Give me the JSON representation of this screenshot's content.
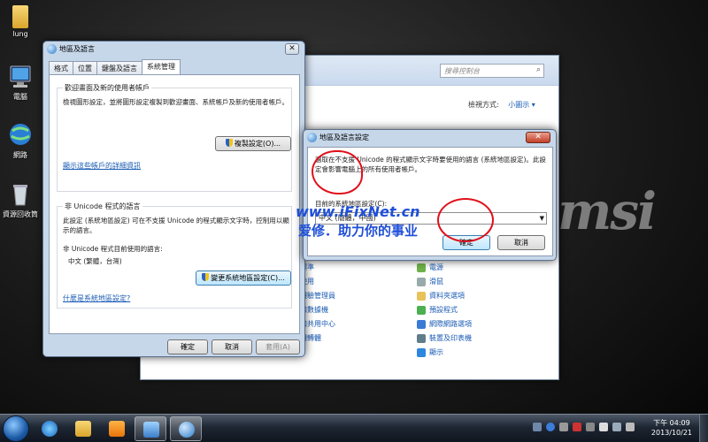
{
  "desktop": {
    "icons": [
      {
        "label": "lung",
        "icon": "folder-icon"
      },
      {
        "label": "電腦",
        "icon": "computer-icon"
      },
      {
        "label": "網路",
        "icon": "network-icon"
      },
      {
        "label": "資源回收筒",
        "icon": "recycle-bin-icon"
      }
    ],
    "brand_logo": "msi"
  },
  "control_panel": {
    "search_placeholder": "搜尋控制台",
    "view_by_label": "檢視方式:",
    "view_by_value": "小圖示 ▾",
    "close_label": "✕",
    "items_left": [
      "標準",
      "使用",
      "體驗管理員",
      "和數據機",
      "和共用中心",
      "體轉體"
    ],
    "items_right": [
      "電源",
      "滑鼠",
      "資料夾選項",
      "預設程式",
      "網際網路選項",
      "裝置及印表機",
      "顯示"
    ]
  },
  "region_dialog": {
    "title": "地區及語言",
    "tabs": [
      "格式",
      "位置",
      "鍵盤及語言",
      "系統管理"
    ],
    "active_tab": "系統管理",
    "welcome_group": {
      "title": "歡迎畫面及新的使用者帳戶",
      "text": "檢視圖形設定，並將圖形設定複製到歡迎畫面、系統帳戶及新的使用者帳戶。",
      "copy_button": "複製設定(O)...",
      "link": "顯示這些帳戶的詳細資訊"
    },
    "unicode_group": {
      "title": "非 Unicode 程式的語言",
      "text": "此設定 (系統地區設定) 可在不支援 Unicode 的程式顯示文字時，控制用以顯示的語言。",
      "current_label": "非 Unicode 程式目前使用的語言:",
      "current_value": "中文 (繁體，台灣)",
      "change_button": "變更系統地區設定(C)...",
      "link": "什麼是系統地區設定?"
    },
    "ok": "確定",
    "cancel": "取消",
    "apply": "套用(A)"
  },
  "locale_dialog": {
    "title": "地區及語言設定",
    "close_label": "✕",
    "text": "選取在不支援 Unicode 的程式顯示文字時要使用的語言 (系統地區設定)。此設定會影響電腦上的所有使用者帳戶。",
    "current_label": "目前的系統地區設定(C):",
    "selected_value": "中文 (簡體，中國)",
    "ok": "確定",
    "cancel": "取消"
  },
  "watermark": {
    "line1": "www.iFixNet.cn",
    "line2": "爱修．助力你的事业"
  },
  "taskbar": {
    "time": "下午 04:09",
    "date": "2013/10/21"
  },
  "colors": {
    "annotation_red": "#e0101a",
    "watermark_blue": "#1f4fd8",
    "link_blue": "#1a5bb4"
  }
}
